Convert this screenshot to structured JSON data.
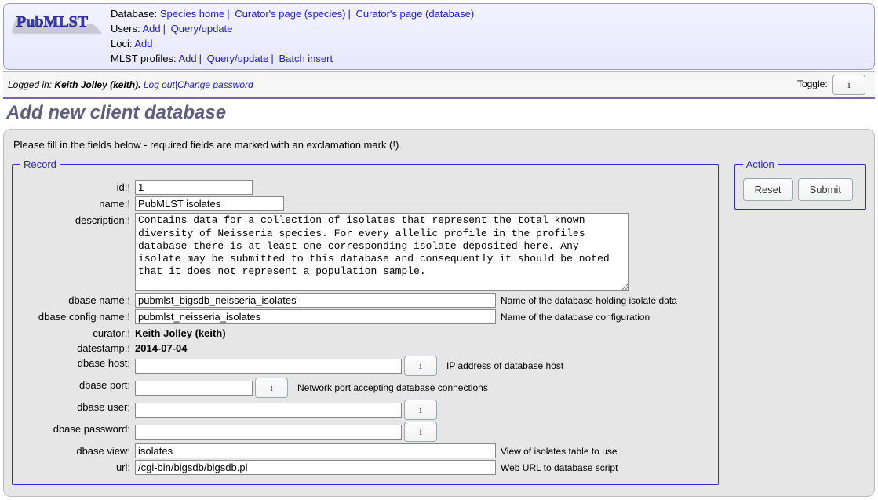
{
  "header": {
    "database_label": "Database:",
    "links_db": [
      "Species home",
      "Curator's page (species)",
      "Curator's page (database)"
    ],
    "users_label": "Users:",
    "links_users": [
      "Add",
      "Query/update"
    ],
    "loci_label": "Loci:",
    "links_loci": [
      "Add"
    ],
    "mlst_label": "MLST profiles:",
    "links_mlst": [
      "Add",
      "Query/update",
      "Batch insert"
    ]
  },
  "auth": {
    "logged_in_label": "Logged in:",
    "user_display": "Keith Jolley (keith).",
    "logout": "Log out",
    "change_pw": "Change password",
    "toggle_label": "Toggle:"
  },
  "title": "Add new client database",
  "preamble": "Please fill in the fields below - required fields are marked with an exclamation mark (!).",
  "legend_record": "Record",
  "legend_action": "Action",
  "buttons": {
    "reset": "Reset",
    "submit": "Submit"
  },
  "fields": {
    "id": {
      "label": "id:!",
      "value": "1"
    },
    "name": {
      "label": "name:!",
      "value": "PubMLST isolates"
    },
    "description": {
      "label": "description:!",
      "value": "Contains data for a collection of isolates that represent the total known diversity of Neisseria species. For every allelic profile in the profiles database there is at least one corresponding isolate deposited here. Any isolate may be submitted to this database and consequently it should be noted that it does not represent a population sample."
    },
    "dbase_name": {
      "label": "dbase name:!",
      "value": "pubmlst_bigsdb_neisseria_isolates",
      "hint": "Name of the database holding isolate data"
    },
    "dbase_config": {
      "label": "dbase config name:!",
      "value": "pubmlst_neisseria_isolates",
      "hint": "Name of the database configuration"
    },
    "curator": {
      "label": "curator:!",
      "value": "Keith Jolley (keith)"
    },
    "datestamp": {
      "label": "datestamp:!",
      "value": "2014-07-04"
    },
    "dbase_host": {
      "label": "dbase host:",
      "value": "",
      "hint": "IP address of database host"
    },
    "dbase_port": {
      "label": "dbase port:",
      "value": "",
      "hint": "Network port accepting database connections"
    },
    "dbase_user": {
      "label": "dbase user:",
      "value": ""
    },
    "dbase_password": {
      "label": "dbase password:",
      "value": ""
    },
    "dbase_view": {
      "label": "dbase view:",
      "value": "isolates",
      "hint": "View of isolates table to use"
    },
    "url": {
      "label": "url:",
      "value": "/cgi-bin/bigsdb/bigsdb.pl",
      "hint": "Web URL to database script"
    }
  }
}
